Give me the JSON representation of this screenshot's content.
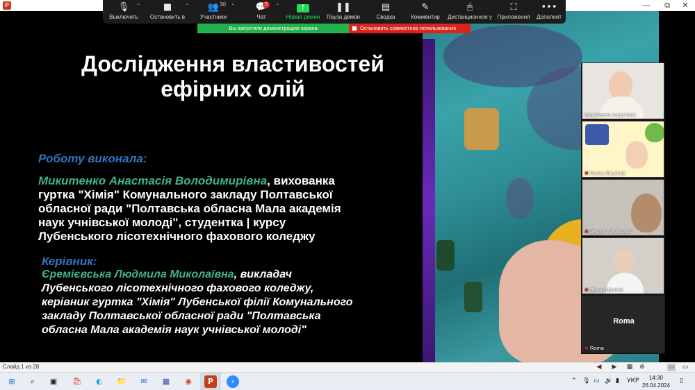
{
  "window": {
    "app_icon": "P",
    "controls": [
      "—",
      "⧉",
      "✕"
    ]
  },
  "slide": {
    "title_line1": "Дослідження властивостей",
    "title_line2": "ефірних олій",
    "performed_label": "Роботу виконала:",
    "author_name": "Микитенко Анастасія Володимирівна",
    "author_text1": ", вихованка",
    "author_text2": "гуртка \"Хімія\" Комунального закладу Полтавської",
    "author_text3": "обласної ради \"Полтавська обласна Мала академія",
    "author_text4": "наук учнівської молоді\", студентка | курсу",
    "author_text5": "Лубенського лісотехнічного фахового коледжу",
    "supervisor_label": "Керівник:",
    "supervisor_name": "Єремієвська Людмила Миколаївна",
    "supervisor_text1": ",  викладач",
    "supervisor_text2": "Лубенського лісотехнічного фахового коледжу,",
    "supervisor_text3": "керівник гуртка \"Хімія\" Лубенської філії Комунального",
    "supervisor_text4": "закладу Полтавської обласної ради \"Полтавська",
    "supervisor_text5": "обласна Мала академія наук учнівської молоді\""
  },
  "zoom_toolbar": {
    "mute": {
      "label": "Выключить",
      "icon": "microphone-icon"
    },
    "video": {
      "label": "Остановить в",
      "icon": "video-camera-icon"
    },
    "participants": {
      "label": "Участники",
      "count": "30",
      "icon": "participants-icon"
    },
    "chat": {
      "label": "Чат",
      "badge": "5",
      "icon": "chat-icon"
    },
    "new_share": {
      "label": "Новая демон",
      "icon": "share-screen-icon"
    },
    "pause_share": {
      "label": "Пауза демон",
      "icon": "pause-icon"
    },
    "summary": {
      "label": "Сводка",
      "icon": "summary-icon"
    },
    "annotate": {
      "label": "Комментир",
      "icon": "pencil-icon"
    },
    "remote": {
      "label": "Дистанционное у",
      "icon": "remote-control-icon"
    },
    "apps": {
      "label": "Приложения",
      "icon": "apps-icon"
    },
    "more": {
      "label": "Дополнит",
      "icon": "more-icon"
    }
  },
  "share_banner": {
    "text": "Вы запустили демонстрацию экрана",
    "stop_label": "Остановить совместное использование"
  },
  "participants": [
    {
      "name": "Микитенко Анастасія",
      "muted": false
    },
    {
      "name": "Diana Stryzhak",
      "muted": true
    },
    {
      "name": "Деркач Анастасія",
      "muted": true
    },
    {
      "name": "Денис Шилкін",
      "muted": true
    },
    {
      "name": "Roma",
      "muted": true,
      "display_text": "Roma"
    }
  ],
  "statusbar": {
    "slide_indicator": "Слайд 1 из 28"
  },
  "taskbar": {
    "tray_lang": "УКР",
    "time": "14:30",
    "date": "26.04.2024"
  },
  "colors": {
    "slide_bg": "#000000",
    "heading_blue": "#2f74c0",
    "name_green": "#3fb28c",
    "share_green": "#23b14d",
    "stop_red": "#d9261c"
  }
}
